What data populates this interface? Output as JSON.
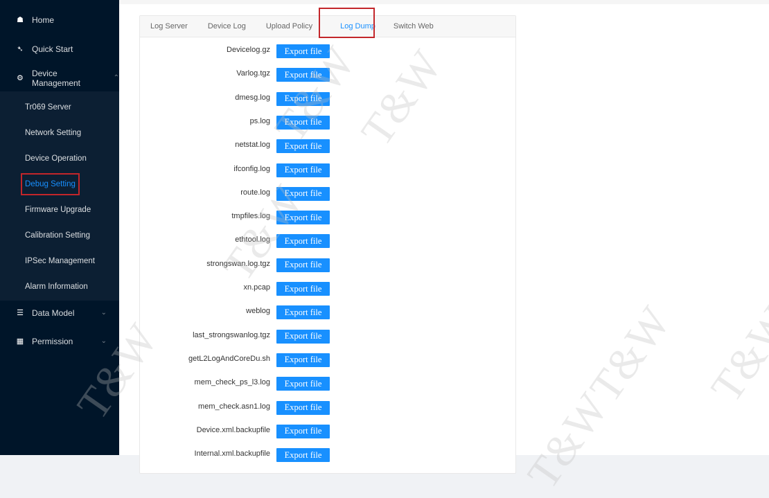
{
  "sidebar": {
    "home": {
      "label": "Home",
      "icon": "home-icon"
    },
    "quick_start": {
      "label": "Quick Start",
      "icon": "send-icon"
    },
    "device_management": {
      "label": "Device Management",
      "icon": "gear-icon"
    },
    "device_submenu": [
      {
        "label": "Tr069 Server"
      },
      {
        "label": "Network Setting"
      },
      {
        "label": "Device Operation"
      },
      {
        "label": "Debug Setting",
        "active": true
      },
      {
        "label": "Firmware Upgrade"
      },
      {
        "label": "Calibration Setting"
      },
      {
        "label": "IPSec Management"
      },
      {
        "label": "Alarm Information"
      }
    ],
    "data_model": {
      "label": "Data Model",
      "icon": "database-icon"
    },
    "permission": {
      "label": "Permission",
      "icon": "id-card-icon"
    }
  },
  "tabs": [
    {
      "label": "Log Server"
    },
    {
      "label": "Device Log"
    },
    {
      "label": "Upload Policy"
    },
    {
      "label": "Log Dump",
      "active": true
    },
    {
      "label": "Switch Web"
    }
  ],
  "export_button_label": "Export file",
  "files": [
    "Devicelog.gz",
    "Varlog.tgz",
    "dmesg.log",
    "ps.log",
    "netstat.log",
    "ifconfig.log",
    "route.log",
    "tmpfiles.log",
    "ethtool.log",
    "strongswan.log.tgz",
    "xn.pcap",
    "weblog",
    "last_strongswanlog.tgz",
    "getL2LogAndCoreDu.sh",
    "mem_check_ps_l3.log",
    "mem_check.asn1.log",
    "Device.xml.backupfile",
    "Internal.xml.backupfile"
  ],
  "watermark": "T&W",
  "colors": {
    "sidebar_bg": "#001529",
    "accent": "#1890ff",
    "highlight_border": "#c3262a"
  }
}
